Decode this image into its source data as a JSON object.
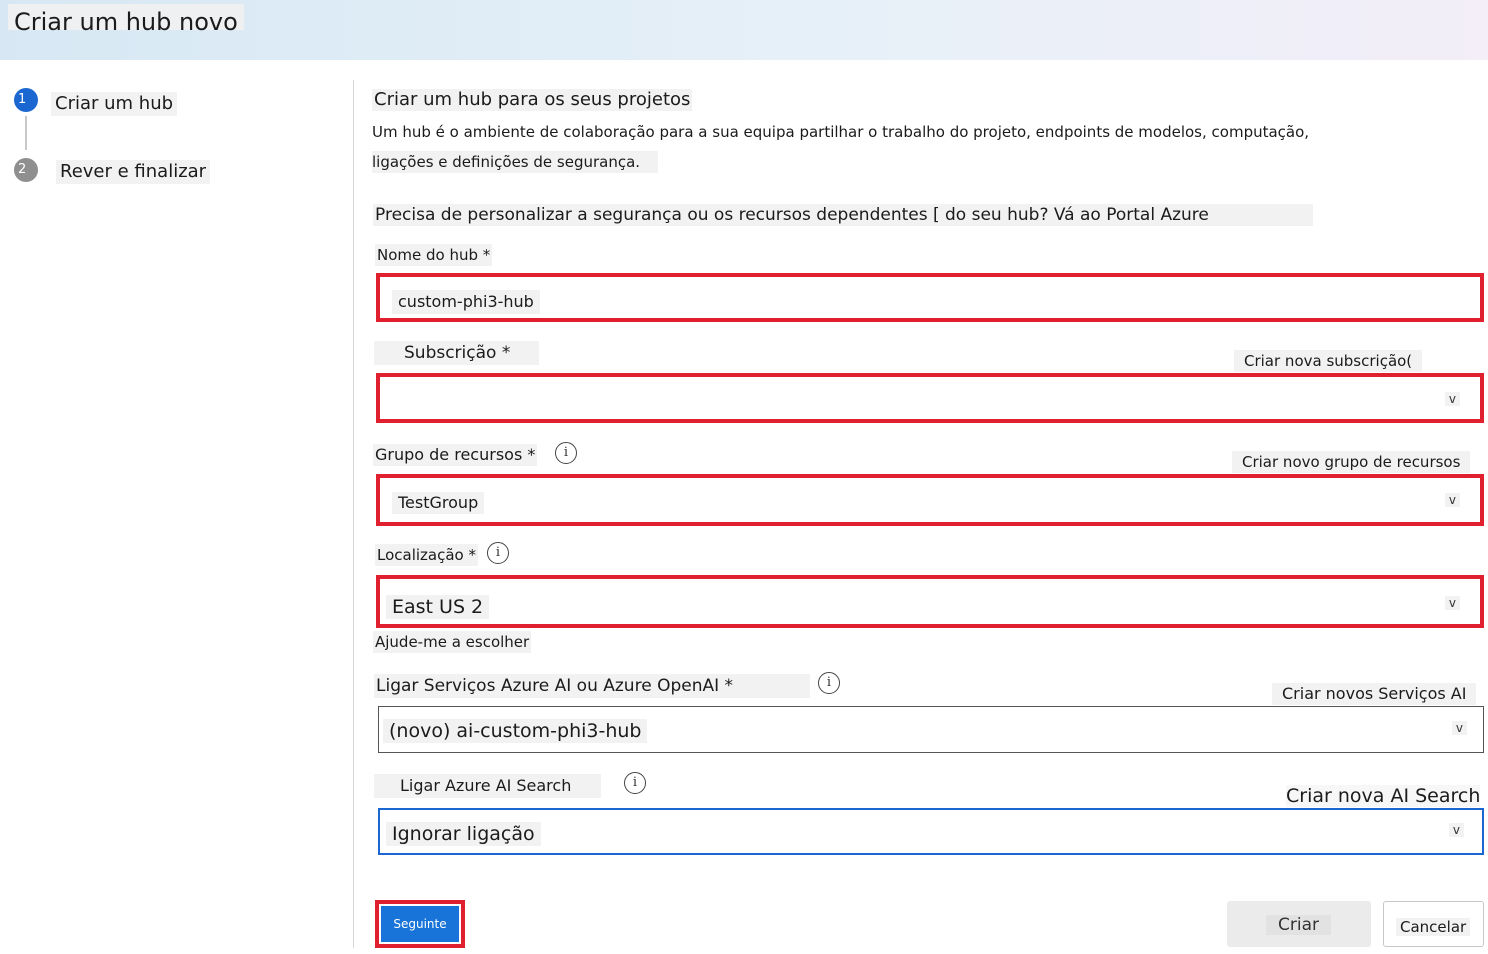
{
  "header": {
    "title": "Criar um hub novo"
  },
  "steps": [
    {
      "number": "1",
      "label": "Criar um hub"
    },
    {
      "number": "2",
      "label": "Rever e finalizar"
    }
  ],
  "main": {
    "heading": "Criar um hub para os seus projetos",
    "description_line1": "Um hub é o ambiente de colaboração para a sua equipa partilhar o trabalho do projeto, endpoints de modelos, computação,",
    "description_line2": "ligações e definições de segurança.",
    "customize_text": "Precisa de personalizar a segurança ou os recursos dependentes [ do seu hub? Vá ao Portal Azure"
  },
  "form": {
    "hub_name": {
      "label": "Nome do hub *",
      "value": "custom-phi3-hub"
    },
    "subscription": {
      "label": "Subscrição *",
      "value": "",
      "link": "Criar nova subscrição("
    },
    "resource_group": {
      "label": "Grupo de recursos *",
      "value": "TestGroup",
      "link": "Criar novo grupo de recursos"
    },
    "location": {
      "label": "Localização *",
      "value": "East US 2",
      "help": "Ajude-me a escolher"
    },
    "ai_services": {
      "label": "Ligar Serviços Azure AI ou Azure OpenAI *",
      "value": "(novo) ai-custom-phi3-hub",
      "link": "Criar novos Serviços AI"
    },
    "ai_search": {
      "label": "Ligar Azure AI Search",
      "value": "Ignorar ligação",
      "link": "Criar nova AI Search"
    }
  },
  "glyphs": {
    "chevron": "v",
    "info": "i"
  },
  "buttons": {
    "next": "Seguinte",
    "create": "Criar",
    "cancel": "Cancelar"
  },
  "colors": {
    "accent": "#1874d8",
    "highlight": "#e0202e",
    "focus": "#1b67d1"
  }
}
